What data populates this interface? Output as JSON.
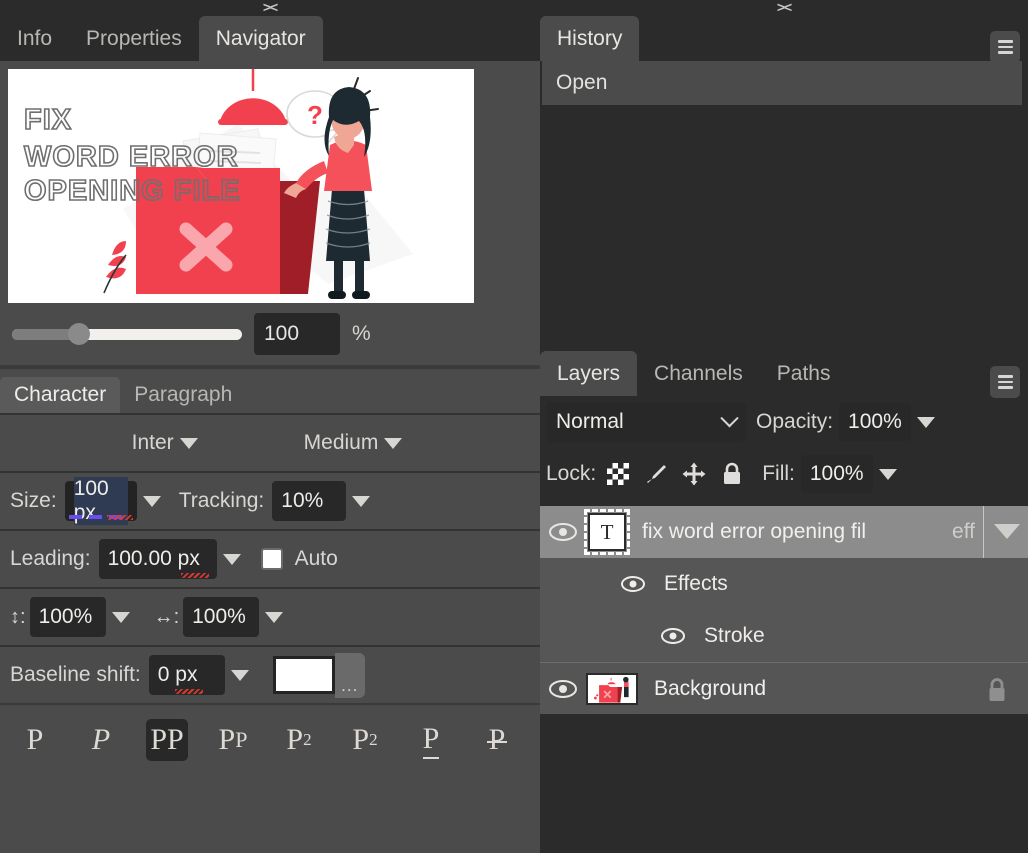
{
  "left_dock": {
    "collapse_glyph": "><",
    "tabs": [
      {
        "label": "Info",
        "active": false
      },
      {
        "label": "Properties",
        "active": false
      },
      {
        "label": "Navigator",
        "active": true
      }
    ]
  },
  "navigator": {
    "zoom_value": "100",
    "zoom_unit": "%",
    "slider_position_pct": 25,
    "thumbnail": {
      "headline_line1": "FIX",
      "headline_line2": "WORD ERROR",
      "headline_line3": "OPENING FILE",
      "question_mark": "?",
      "colors": {
        "accent_red": "#F2414E",
        "dark_red": "#A01E28",
        "paper_gray": "#EFEFEF",
        "skin": "#F0A694",
        "hair_dark": "#1E2A32",
        "background": "#FFFFFF"
      }
    }
  },
  "character_panel": {
    "tabs": [
      {
        "label": "Character",
        "active": true
      },
      {
        "label": "Paragraph",
        "active": false
      }
    ],
    "font_family": "Inter",
    "font_style": "Medium",
    "size_label": "Size:",
    "size_value": "100 px",
    "tracking_label": "Tracking:",
    "tracking_value": "10%",
    "leading_label": "Leading:",
    "leading_value": "100.00 px",
    "auto_label": "Auto",
    "auto_checked": false,
    "vertical_scale_label": "↕:",
    "vertical_scale_value": "100%",
    "horizontal_scale_label": "↔:",
    "horizontal_scale_value": "100%",
    "baseline_label": "Baseline shift:",
    "baseline_value": "0 px",
    "color_swatch": "#FFFFFF",
    "color_more_label": "...",
    "style_buttons": [
      {
        "name": "regular",
        "glyph": "P",
        "active": false
      },
      {
        "name": "italic",
        "glyph": "P",
        "active": false
      },
      {
        "name": "bold-all-caps",
        "glyph": "PP",
        "active": true
      },
      {
        "name": "small-caps",
        "glyph": "P",
        "active": false
      },
      {
        "name": "superscript",
        "glyph": "P",
        "sup": "2",
        "active": false
      },
      {
        "name": "subscript",
        "glyph": "P",
        "sub": "2",
        "active": false
      },
      {
        "name": "underline",
        "glyph": "P",
        "active": false
      },
      {
        "name": "strikethrough",
        "glyph": "P",
        "active": false
      }
    ]
  },
  "right_dock": {
    "collapse_glyph": "><",
    "history": {
      "tabs": [
        {
          "label": "History",
          "active": true
        }
      ],
      "items": [
        "Open"
      ]
    },
    "layers": {
      "tabs": [
        {
          "label": "Layers",
          "active": true
        },
        {
          "label": "Channels",
          "active": false
        },
        {
          "label": "Paths",
          "active": false
        }
      ],
      "blend_mode": "Normal",
      "opacity_label": "Opacity:",
      "opacity_value": "100%",
      "lock_label": "Lock:",
      "lock_icons": [
        "transparency-icon",
        "brush-icon",
        "move-icon",
        "lock-all-icon"
      ],
      "fill_label": "Fill:",
      "fill_value": "100%",
      "rows": [
        {
          "name": "fix word error opening fil",
          "type": "text",
          "selected": true,
          "visible": true,
          "effects_badge": "eff",
          "indent": 0
        },
        {
          "name": "Effects",
          "type": "effects-group",
          "selected": false,
          "visible": true,
          "indent": 1
        },
        {
          "name": "Stroke",
          "type": "effect",
          "selected": false,
          "visible": true,
          "indent": 2
        },
        {
          "name": "Background",
          "type": "image",
          "selected": false,
          "visible": true,
          "locked": true,
          "indent": 0
        }
      ]
    }
  }
}
